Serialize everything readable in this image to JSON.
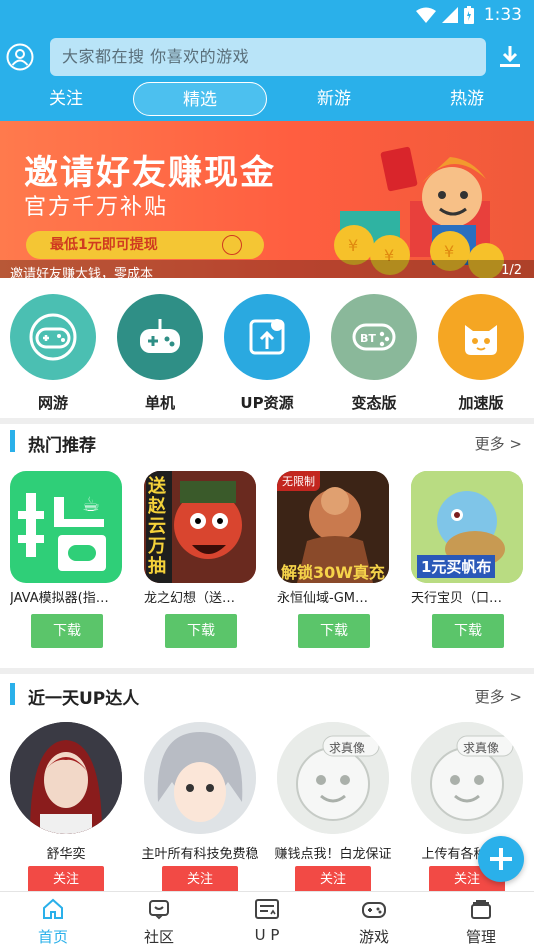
{
  "status_bar": {
    "time": "1:33"
  },
  "search": {
    "placeholder": "大家都在搜  你喜欢的游戏"
  },
  "tabs": [
    {
      "label": "关注"
    },
    {
      "label": "精选",
      "active": true
    },
    {
      "label": "新游"
    },
    {
      "label": "热游"
    }
  ],
  "banner": {
    "title": "邀请好友赚现金",
    "subtitle": "官方千万补贴",
    "pill": "最低1元即可提现",
    "caption": "邀请好友赚大钱，零成本",
    "counter": "1/2"
  },
  "categories": [
    {
      "label": "网游",
      "icon": "gamepad-ring-icon",
      "color": "#4bbfb2"
    },
    {
      "label": "单机",
      "icon": "gamepad-icon",
      "color": "#2f8f86"
    },
    {
      "label": "UP资源",
      "icon": "upload-share-icon",
      "color": "#2aa9e0"
    },
    {
      "label": "变态版",
      "icon": "bt-gamepad-icon",
      "color": "#8ab89a"
    },
    {
      "label": "加速版",
      "icon": "cat-face-icon",
      "color": "#f5a623"
    }
  ],
  "hot": {
    "title": "热门推荐",
    "more": "更多 >",
    "items": [
      {
        "name": "JAVA模拟器(指…",
        "button": "下载"
      },
      {
        "name": "龙之幻想（送…",
        "button": "下载",
        "art_text": "送赵云万抽"
      },
      {
        "name": "永恒仙域-GM…",
        "button": "下载",
        "art_text": "解锁30W真充",
        "badge": "无限制"
      },
      {
        "name": "天行宝贝（口…",
        "button": "下载",
        "art_text": "1元买帆布"
      }
    ]
  },
  "up": {
    "title": "近一天UP达人",
    "more": "更多 >",
    "users": [
      {
        "name": "舒华奕",
        "button": "关注"
      },
      {
        "name": "主叶所有科技免费稳",
        "button": "关注"
      },
      {
        "name": "赚钱点我！白龙保证",
        "button": "关注",
        "bubble": "求真像"
      },
      {
        "name": "上传有各种软件",
        "button": "关注",
        "bubble": "求真像"
      }
    ]
  },
  "bottom_nav": [
    {
      "label": "首页",
      "icon": "home-icon",
      "active": true
    },
    {
      "label": "社区",
      "icon": "community-icon"
    },
    {
      "label": "U P",
      "icon": "up-icon"
    },
    {
      "label": "游戏",
      "icon": "gamepad-icon"
    },
    {
      "label": "管理",
      "icon": "manage-icon"
    }
  ],
  "colors": {
    "primary": "#2ab0ea",
    "download": "#5bc56a",
    "follow": "#f24a45"
  }
}
